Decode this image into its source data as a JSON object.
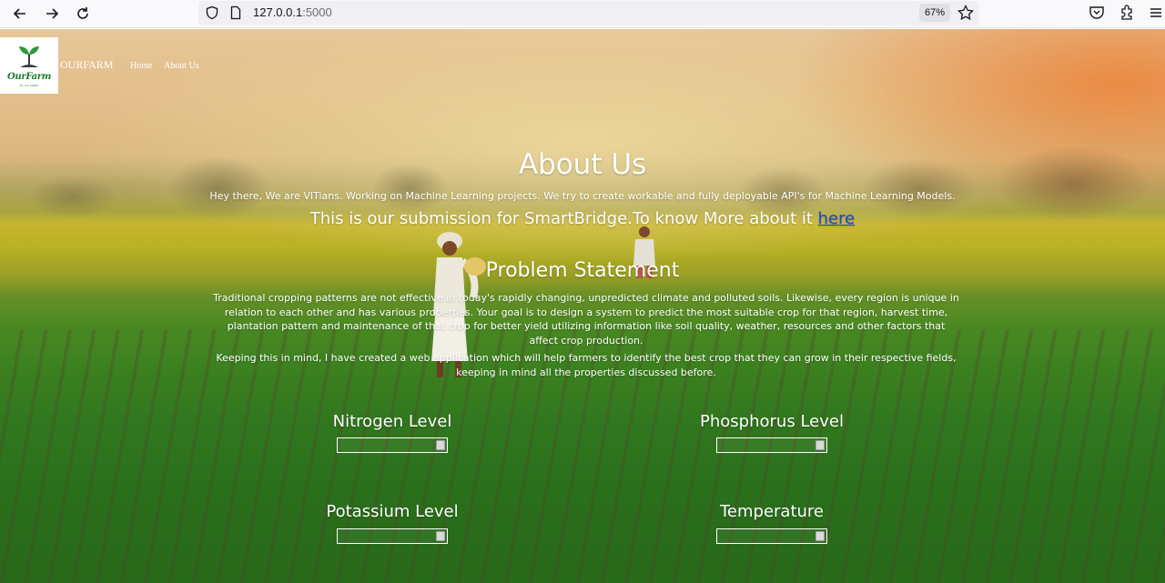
{
  "browser": {
    "url_host": "127.0.0.1",
    "url_port": ":5000",
    "zoom": "67%"
  },
  "navbar": {
    "logo_text": "OurFarm",
    "logo_tagline": "for our health",
    "brand": "OURFARM",
    "links": [
      "Home",
      "About Us"
    ]
  },
  "about": {
    "title": "About Us",
    "intro": "Hey there, We are VITians. Working on Machine Learning projects. We try to create workable and fully deployable API's for Machine Learning Models.",
    "submission_text": "This is our submission for SmartBridge.To know More about it ",
    "submission_link": "here"
  },
  "problem": {
    "title": "Problem Statement",
    "paragraph1": "Traditional cropping patterns are not effective in today's rapidly changing, unpredicted climate and polluted soils. Likewise, every region is unique in relation to each other and has various properties. Your goal is to design a system to predict the most suitable crop for that region, harvest time, plantation pattern and maintenance of that crop for better yield utilizing information like soil quality, weather, resources and other factors that affect crop production.",
    "paragraph2": "Keeping this in mind, I have created a web application which will help farmers to identify the best crop that they can grow in their respective fields, keeping in mind all the properties discussed before."
  },
  "form": {
    "nitrogen_label": "Nitrogen Level",
    "phosphorus_label": "Phosphorus Level",
    "potassium_label": "Potassium Level",
    "temperature_label": "Temperature"
  },
  "colors": {
    "link": "#1a47d6",
    "logo_green": "#1b7a2a"
  }
}
